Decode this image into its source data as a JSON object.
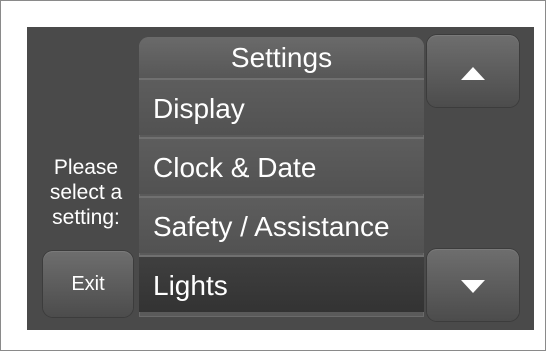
{
  "menu": {
    "title": "Settings",
    "items": [
      {
        "label": "Display"
      },
      {
        "label": "Clock & Date"
      },
      {
        "label": "Safety / Assistance"
      },
      {
        "label": "Lights"
      }
    ],
    "selected_index": 3
  },
  "prompt": {
    "line1": "Please",
    "line2": "select a",
    "line3": "setting:"
  },
  "buttons": {
    "exit_label": "Exit",
    "scroll_up_icon": "triangle-up-icon",
    "scroll_down_icon": "triangle-down-icon"
  },
  "colors": {
    "screen_bg": "#4a4a4a",
    "text": "#ffffff",
    "selected_item_bg": "#353535"
  }
}
